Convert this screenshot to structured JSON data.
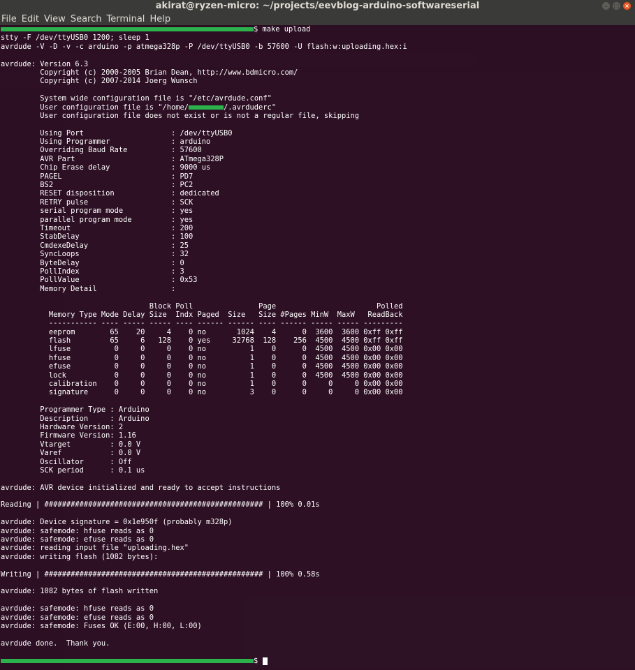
{
  "window": {
    "title": "akirat@ryzen-micro: ~/projects/eevblog-arduino-softwareserial",
    "controls": {
      "minimize": "–",
      "maximize": "□",
      "close": "×"
    }
  },
  "menu": [
    "File",
    "Edit",
    "View",
    "Search",
    "Terminal",
    "Help"
  ],
  "colors": {
    "terminal_bg": "#2c0f23",
    "redaction": "#2bb24c",
    "titlebar": "#3a3a38",
    "close_button": "#e95420"
  },
  "terminal": {
    "prompt_suffix": "$",
    "command": " make upload",
    "lines": [
      "stty -F /dev/ttyUSB0 1200; sleep 1",
      "avrdude -V -D -v -c arduino -p atmega328p -P /dev/ttyUSB0 -b 57600 -U flash:w:uploading.hex:i",
      "",
      "avrdude: Version 6.3",
      "         Copyright (c) 2000-2005 Brian Dean, http://www.bdmicro.com/",
      "         Copyright (c) 2007-2014 Joerg Wunsch",
      "",
      "         System wide configuration file is \"/etc/avrdude.conf\"",
      "         User configuration file is \"/home/        /.avrduderc\"",
      "         User configuration file does not exist or is not a regular file, skipping",
      "",
      "         Using Port                    : /dev/ttyUSB0",
      "         Using Programmer              : arduino",
      "         Overriding Baud Rate          : 57600",
      "         AVR Part                      : ATmega328P",
      "         Chip Erase delay              : 9000 us",
      "         PAGEL                         : PD7",
      "         BS2                           : PC2",
      "         RESET disposition             : dedicated",
      "         RETRY pulse                   : SCK",
      "         serial program mode           : yes",
      "         parallel program mode         : yes",
      "         Timeout                       : 200",
      "         StabDelay                     : 100",
      "         CmdexeDelay                   : 25",
      "         SyncLoops                     : 32",
      "         ByteDelay                     : 0",
      "         PollIndex                     : 3",
      "         PollValue                     : 0x53",
      "         Memory Detail                 :",
      "",
      "                                  Block Poll               Page                       Polled",
      "           Memory Type Mode Delay Size  Indx Paged  Size   Size #Pages MinW  MaxW   ReadBack",
      "           ----------- ---- ----- ----- ---- ------ ------ ---- ------ ----- ----- ---------",
      "           eeprom        65    20     4    0 no       1024    4      0  3600  3600 0xff 0xff",
      "           flash         65     6   128    0 yes     32768  128    256  4500  4500 0xff 0xff",
      "           lfuse          0     0     0    0 no          1    0      0  4500  4500 0x00 0x00",
      "           hfuse          0     0     0    0 no          1    0      0  4500  4500 0x00 0x00",
      "           efuse          0     0     0    0 no          1    0      0  4500  4500 0x00 0x00",
      "           lock           0     0     0    0 no          1    0      0  4500  4500 0x00 0x00",
      "           calibration    0     0     0    0 no          1    0      0     0     0 0x00 0x00",
      "           signature      0     0     0    0 no          3    0      0     0     0 0x00 0x00",
      "",
      "         Programmer Type : Arduino",
      "         Description     : Arduino",
      "         Hardware Version: 2",
      "         Firmware Version: 1.16",
      "         Vtarget         : 0.0 V",
      "         Varef           : 0.0 V",
      "         Oscillator      : Off",
      "         SCK period      : 0.1 us",
      "",
      "avrdude: AVR device initialized and ready to accept instructions",
      "",
      "Reading | ################################################## | 100% 0.01s",
      "",
      "avrdude: Device signature = 0x1e950f (probably m328p)",
      "avrdude: safemode: hfuse reads as 0",
      "avrdude: safemode: efuse reads as 0",
      "avrdude: reading input file \"uploading.hex\"",
      "avrdude: writing flash (1082 bytes):",
      "",
      "Writing | ################################################## | 100% 0.58s",
      "",
      "avrdude: 1082 bytes of flash written",
      "",
      "avrdude: safemode: hfuse reads as 0",
      "avrdude: safemode: efuse reads as 0",
      "avrdude: safemode: Fuses OK (E:00, H:00, L:00)",
      "",
      "avrdude done.  Thank you.",
      ""
    ]
  }
}
